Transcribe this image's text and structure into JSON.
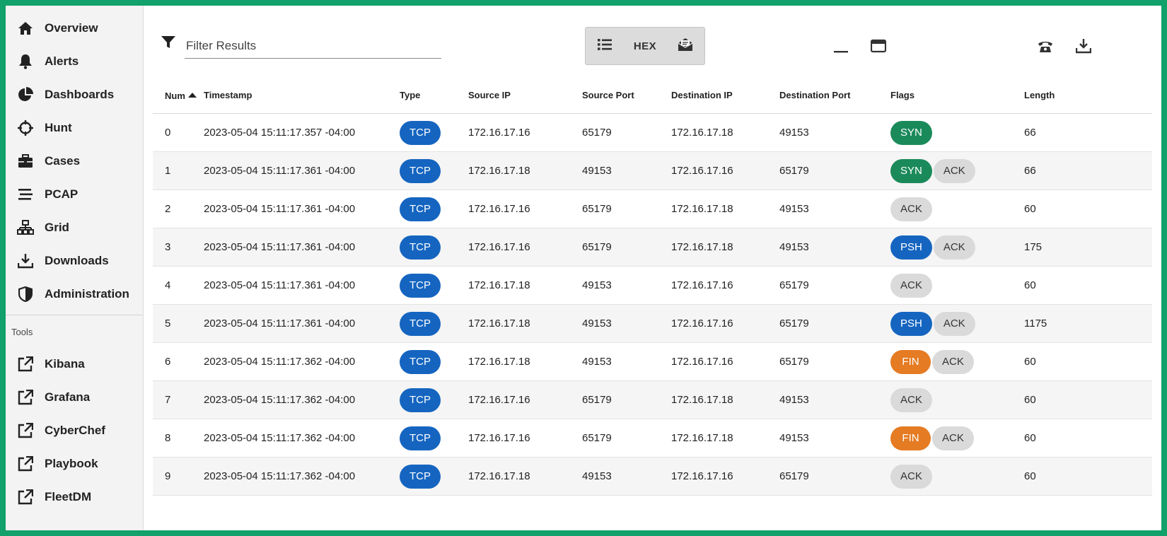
{
  "sidebar": {
    "items": [
      {
        "label": "Overview",
        "icon": "home-icon"
      },
      {
        "label": "Alerts",
        "icon": "bell-icon"
      },
      {
        "label": "Dashboards",
        "icon": "pie-chart-icon"
      },
      {
        "label": "Hunt",
        "icon": "crosshairs-icon"
      },
      {
        "label": "Cases",
        "icon": "briefcase-icon"
      },
      {
        "label": "PCAP",
        "icon": "stream-icon"
      },
      {
        "label": "Grid",
        "icon": "network-icon"
      },
      {
        "label": "Downloads",
        "icon": "download-icon"
      },
      {
        "label": "Administration",
        "icon": "shield-icon"
      }
    ],
    "tools_title": "Tools",
    "tools": [
      {
        "label": "Kibana",
        "icon": "external-link-icon"
      },
      {
        "label": "Grafana",
        "icon": "external-link-icon"
      },
      {
        "label": "CyberChef",
        "icon": "external-link-icon"
      },
      {
        "label": "Playbook",
        "icon": "external-link-icon"
      },
      {
        "label": "FleetDM",
        "icon": "external-link-icon"
      }
    ]
  },
  "toolbar": {
    "filter_placeholder": "Filter Results",
    "view_hex_label": "HEX",
    "icons": {
      "filter": "filter-icon",
      "list_view": "list-icon",
      "case_view": "envelope-open-icon",
      "minimize": "minimize-icon",
      "calendar": "calendar-icon",
      "phone": "phone-icon",
      "download": "download-icon"
    }
  },
  "table": {
    "columns": [
      "Num",
      "Timestamp",
      "Type",
      "Source IP",
      "Source Port",
      "Destination IP",
      "Destination Port",
      "Flags",
      "Length"
    ],
    "rows": [
      {
        "num": "0",
        "ts": "2023-05-04 15:11:17.357 -04:00",
        "type": "TCP",
        "src_ip": "172.16.17.16",
        "src_port": "65179",
        "dst_ip": "172.16.17.18",
        "dst_port": "49153",
        "flags": [
          "SYN"
        ],
        "length": "66"
      },
      {
        "num": "1",
        "ts": "2023-05-04 15:11:17.361 -04:00",
        "type": "TCP",
        "src_ip": "172.16.17.18",
        "src_port": "49153",
        "dst_ip": "172.16.17.16",
        "dst_port": "65179",
        "flags": [
          "SYN",
          "ACK"
        ],
        "length": "66"
      },
      {
        "num": "2",
        "ts": "2023-05-04 15:11:17.361 -04:00",
        "type": "TCP",
        "src_ip": "172.16.17.16",
        "src_port": "65179",
        "dst_ip": "172.16.17.18",
        "dst_port": "49153",
        "flags": [
          "ACK"
        ],
        "length": "60"
      },
      {
        "num": "3",
        "ts": "2023-05-04 15:11:17.361 -04:00",
        "type": "TCP",
        "src_ip": "172.16.17.16",
        "src_port": "65179",
        "dst_ip": "172.16.17.18",
        "dst_port": "49153",
        "flags": [
          "PSH",
          "ACK"
        ],
        "length": "175"
      },
      {
        "num": "4",
        "ts": "2023-05-04 15:11:17.361 -04:00",
        "type": "TCP",
        "src_ip": "172.16.17.18",
        "src_port": "49153",
        "dst_ip": "172.16.17.16",
        "dst_port": "65179",
        "flags": [
          "ACK"
        ],
        "length": "60"
      },
      {
        "num": "5",
        "ts": "2023-05-04 15:11:17.361 -04:00",
        "type": "TCP",
        "src_ip": "172.16.17.18",
        "src_port": "49153",
        "dst_ip": "172.16.17.16",
        "dst_port": "65179",
        "flags": [
          "PSH",
          "ACK"
        ],
        "length": "1175"
      },
      {
        "num": "6",
        "ts": "2023-05-04 15:11:17.362 -04:00",
        "type": "TCP",
        "src_ip": "172.16.17.18",
        "src_port": "49153",
        "dst_ip": "172.16.17.16",
        "dst_port": "65179",
        "flags": [
          "FIN",
          "ACK"
        ],
        "length": "60"
      },
      {
        "num": "7",
        "ts": "2023-05-04 15:11:17.362 -04:00",
        "type": "TCP",
        "src_ip": "172.16.17.16",
        "src_port": "65179",
        "dst_ip": "172.16.17.18",
        "dst_port": "49153",
        "flags": [
          "ACK"
        ],
        "length": "60"
      },
      {
        "num": "8",
        "ts": "2023-05-04 15:11:17.362 -04:00",
        "type": "TCP",
        "src_ip": "172.16.17.16",
        "src_port": "65179",
        "dst_ip": "172.16.17.18",
        "dst_port": "49153",
        "flags": [
          "FIN",
          "ACK"
        ],
        "length": "60"
      },
      {
        "num": "9",
        "ts": "2023-05-04 15:11:17.362 -04:00",
        "type": "TCP",
        "src_ip": "172.16.17.18",
        "src_port": "49153",
        "dst_ip": "172.16.17.16",
        "dst_port": "65179",
        "flags": [
          "ACK"
        ],
        "length": "60"
      }
    ]
  },
  "colors": {
    "frame": "#12a06b",
    "tcp": "#1565c0",
    "syn": "#1b8a5a",
    "psh": "#1565c0",
    "fin": "#e57b23",
    "ack": "#dadada"
  }
}
